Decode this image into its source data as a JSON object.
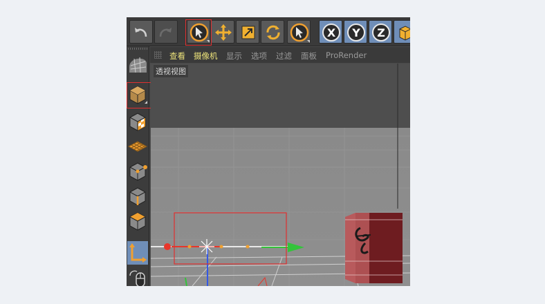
{
  "menubar": {
    "items": [
      {
        "label": "查看",
        "highlight": true
      },
      {
        "label": "摄像机",
        "highlight": true
      },
      {
        "label": "显示",
        "highlight": false
      },
      {
        "label": "选项",
        "highlight": false
      },
      {
        "label": "过滤",
        "highlight": false
      },
      {
        "label": "面板",
        "highlight": false
      },
      {
        "label": "ProRender",
        "highlight": false
      }
    ]
  },
  "viewport": {
    "label": "透视视图"
  },
  "toolbar": {
    "buttons": [
      "undo",
      "redo",
      "live-select",
      "move",
      "scale",
      "rotate",
      "recent-tool",
      "x-axis",
      "y-axis",
      "z-axis",
      "coordinate-system"
    ],
    "axis_labels": {
      "x": "X",
      "y": "Y",
      "z": "Z"
    }
  },
  "sidebar": {
    "buttons": [
      "mesh-texture",
      "model-mode",
      "texture-mode",
      "workplane",
      "points-mode",
      "edges-mode",
      "polygons-mode",
      "axis-mode",
      "tweak-mode"
    ]
  },
  "colors": {
    "highlight_menu": "#ece27a",
    "accent_orange": "#f0a030",
    "selection_box": "#e03030",
    "axis_x": "#e8352a",
    "axis_y": "#33c43a",
    "axis_z": "#3458e6",
    "cabinet": "#8a2a2c"
  }
}
